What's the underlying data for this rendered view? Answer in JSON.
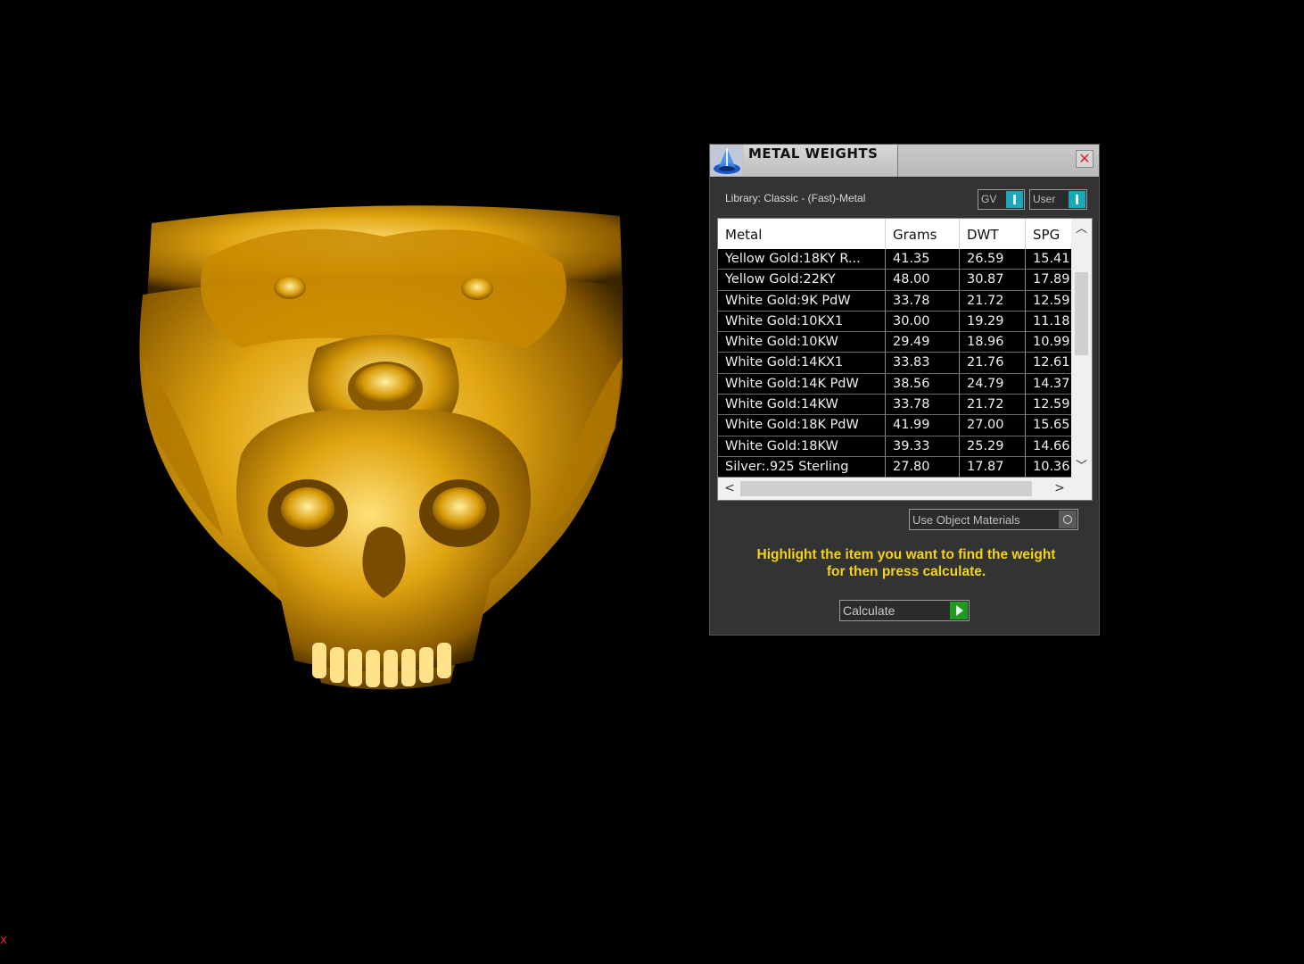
{
  "viewport": {
    "model_icon": "gold-wolf-skull-ring",
    "axis_marker": "x"
  },
  "dialog": {
    "title": "METAL WEIGHTS",
    "library_label": "Library: Classic - (Fast)-Metal",
    "toggles": {
      "gv": "GV",
      "user": "User"
    },
    "table": {
      "columns": [
        "Metal",
        "Grams",
        "DWT",
        "SPG"
      ],
      "rows": [
        [
          "Yellow Gold:18KY R...",
          "41.35",
          "26.59",
          "15.41"
        ],
        [
          "Yellow Gold:22KY",
          "48.00",
          "30.87",
          "17.89"
        ],
        [
          "White Gold:9K PdW",
          "33.78",
          "21.72",
          "12.59"
        ],
        [
          "White Gold:10KX1",
          "30.00",
          "19.29",
          "11.18"
        ],
        [
          "White Gold:10KW",
          "29.49",
          "18.96",
          "10.99"
        ],
        [
          "White Gold:14KX1",
          "33.83",
          "21.76",
          "12.61"
        ],
        [
          "White Gold:14K PdW",
          "38.56",
          "24.79",
          "14.37"
        ],
        [
          "White Gold:14KW",
          "33.78",
          "21.72",
          "12.59"
        ],
        [
          "White Gold:18K PdW",
          "41.99",
          "27.00",
          "15.65"
        ],
        [
          "White Gold:18KW",
          "39.33",
          "25.29",
          "14.66"
        ],
        [
          "Silver:.925 Sterling",
          "27.80",
          "17.87",
          "10.36"
        ]
      ]
    },
    "use_object_materials": "Use Object Materials",
    "hint_line1": "Highlight the item you want to find the weight",
    "hint_line2": "for then press calculate.",
    "calculate_label": "Calculate",
    "colors": {
      "panel": "#333333",
      "hint": "#f2d21a",
      "toggle_on": "#1aa8b8",
      "go": "#1e9a1e"
    }
  }
}
